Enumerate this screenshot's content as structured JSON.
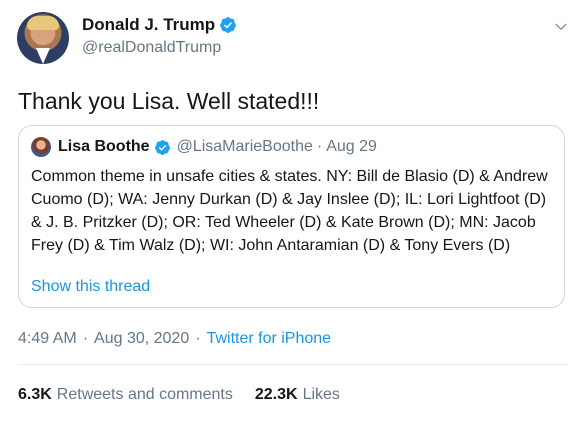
{
  "author": {
    "name": "Donald J. Trump",
    "handle": "@realDonaldTrump",
    "verified": true
  },
  "tweet_text": "Thank you Lisa. Well stated!!!",
  "quoted": {
    "name": "Lisa Boothe",
    "handle": "@LisaMarieBoothe",
    "separator": "·",
    "date": "Aug 29",
    "verified": true,
    "body": "Common theme in unsafe cities & states. NY: Bill de Blasio (D) & Andrew Cuomo (D); WA: Jenny Durkan (D) & Jay Inslee (D); IL: Lori Lightfoot (D) & J. B. Pritzker (D); OR: Ted Wheeler (D) & Kate Brown (D); MN: Jacob Frey (D) & Tim Walz (D); WI: John Antaramian (D) & Tony Evers (D)",
    "show_thread": "Show this thread"
  },
  "meta": {
    "time": "4:49 AM",
    "date": "Aug 30, 2020",
    "separator": "·",
    "source": "Twitter for iPhone"
  },
  "stats": {
    "retweets_count": "6.3K",
    "retweets_label": "Retweets and comments",
    "likes_count": "22.3K",
    "likes_label": "Likes"
  },
  "colors": {
    "link": "#1b95e0",
    "muted": "#657786",
    "verified": "#1da1f2",
    "border": "#ccd6dd"
  },
  "icons": {
    "verified": "verified-badge-icon",
    "menu": "chevron-down-icon"
  }
}
